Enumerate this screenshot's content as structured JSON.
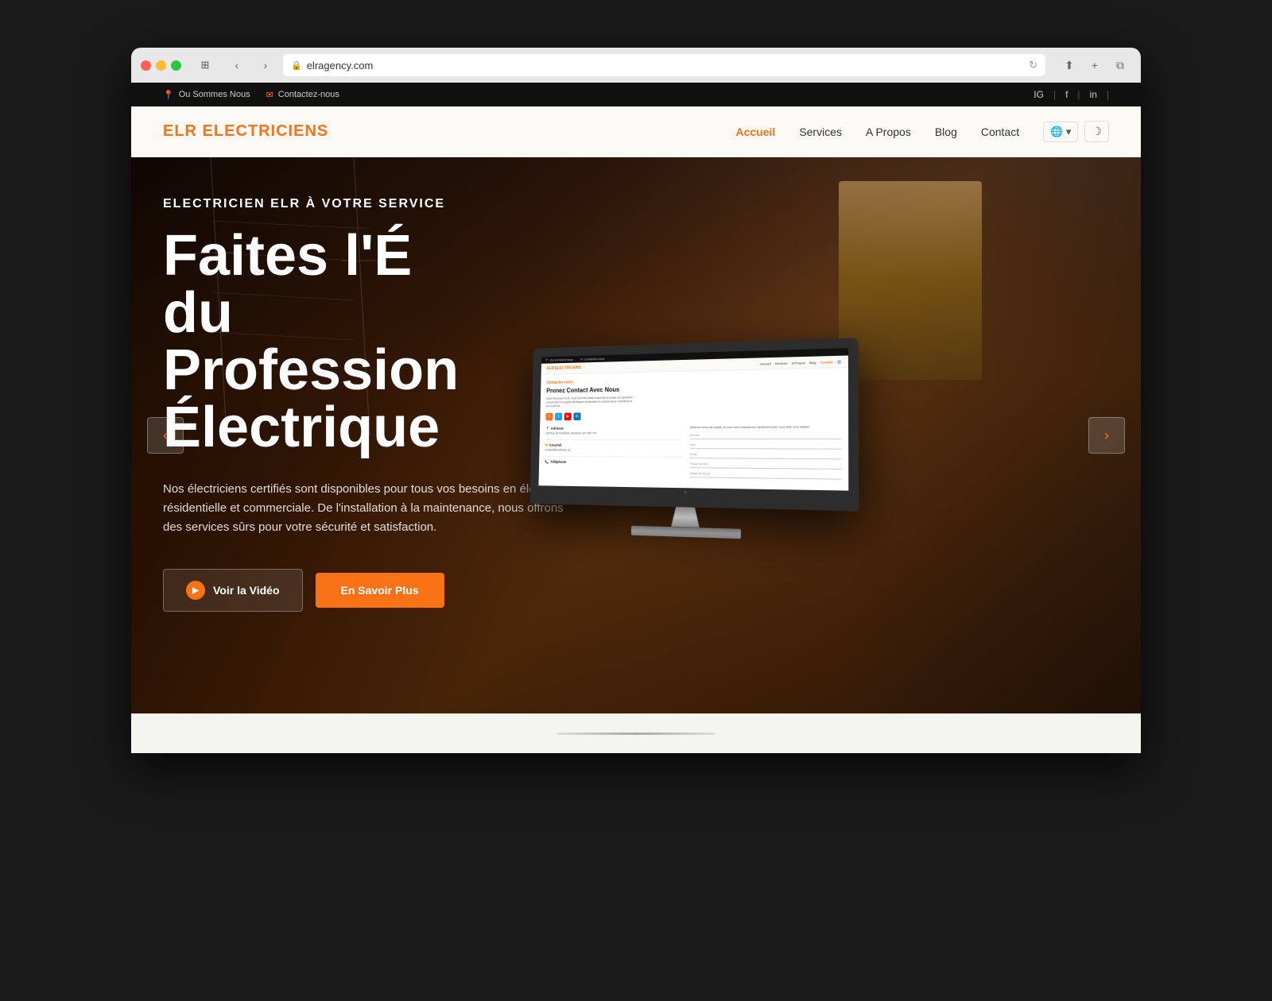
{
  "browser": {
    "url": "elragency.com",
    "tab_icon": "🔒"
  },
  "topbar": {
    "location_label": "Ou Sommes Nous",
    "contact_label": "Contactez-nous",
    "social_icons": [
      "IG",
      "f",
      "in"
    ]
  },
  "nav": {
    "logo": "ELR ELECTRICIENS",
    "links": [
      {
        "label": "Accueil",
        "active": true
      },
      {
        "label": "Services",
        "active": false
      },
      {
        "label": "A Propos",
        "active": false
      },
      {
        "label": "Blog",
        "active": false
      },
      {
        "label": "Contact",
        "active": false
      }
    ],
    "globe_label": "🌐",
    "darkmode_icon": "☽"
  },
  "hero": {
    "subtitle": "ELECTRICIEN ELR À VOTRE SERVICE",
    "title_line1": "Faites l'É",
    "title_line2": "du",
    "title_line3": "Profession",
    "title_line4": "Électrique",
    "description": "Nos électriciens certifiés sont disponibles pour tous vos besoins en électricité résidentielle et commerciale. De l'installation à la maintenance, nous offrons des services sûrs pour votre sécurité et satisfaction.",
    "btn_video": "Voir la Vidéo",
    "btn_savoir": "En Savoir Plus",
    "nav_prev": "‹",
    "nav_next": "›"
  },
  "monitor": {
    "inner_logo": "ELR ELECTRICIENS",
    "inner_contact_label": "Contactez-nous",
    "inner_title": "Prenez Contact Avec Nous",
    "inner_description": "Chez Electricien ELR, nous sommes prêts à répondre à toutes vos questions concernant vos projets électriques résidentiels et commerciaux à Montréal et ses environs.",
    "inner_right_text": "Décrivez-nous vos projets, et nous vous contacterons rapidement pour vous aider à les réaliser.",
    "address_label": "Adresse",
    "address_value": "123 Rue de l'Industrie, Montréal, QC H2K 1X7",
    "email_label": "Courriel",
    "email_value": "contact@electricien.ca",
    "phone_label": "Téléphone",
    "form_fields": [
      "Prénom",
      "Nom",
      "Email",
      "Phone Number",
      "Détails du Projet"
    ],
    "nav_links": [
      "Accueil",
      "Services",
      "A Propos",
      "Blog",
      "Contact"
    ]
  },
  "bottom_bar": {
    "divider": ""
  }
}
